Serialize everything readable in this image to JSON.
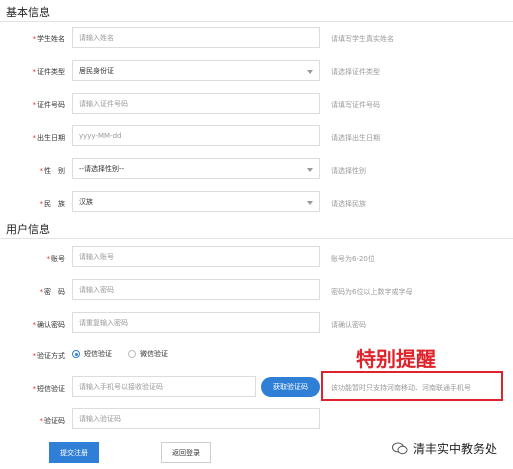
{
  "sections": {
    "basic": "基本信息",
    "user": "用户信息"
  },
  "fields": {
    "name": {
      "label": "学生姓名",
      "required": "*",
      "placeholder": "请输入姓名",
      "hint": "请填写学生真实姓名"
    },
    "idtype": {
      "label": "证件类型",
      "required": "*",
      "value": "居民身份证",
      "hint": "请选择证件类型"
    },
    "idnum": {
      "label": "证件号码",
      "required": "*",
      "placeholder": "请输入证件号码",
      "hint": "请填写证件号码"
    },
    "birth": {
      "label": "出生日期",
      "required": "*",
      "placeholder": "yyyy-MM-dd",
      "hint": "请选择出生日期"
    },
    "gender": {
      "label": "性　别",
      "required": "*",
      "value": "--请选择性别--",
      "hint": "请选择性别"
    },
    "nation": {
      "label": "民　族",
      "required": "*",
      "value": "汉族",
      "hint": "请选择民族"
    },
    "account": {
      "label": "账号",
      "required": "*",
      "placeholder": "请输入账号",
      "hint": "账号为6-20位"
    },
    "password": {
      "label": "密　码",
      "required": "*",
      "placeholder": "请输入密码",
      "hint": "密码为6位以上数字或字母"
    },
    "confirm": {
      "label": "确认密码",
      "required": "*",
      "placeholder": "请重复输入密码",
      "hint": "请确认密码"
    },
    "verify_method": {
      "label": "验证方式",
      "required": "*",
      "options": [
        "短信验证",
        "微信验证"
      ],
      "selected": "短信验证"
    },
    "sms": {
      "label": "短信验证",
      "required": "*",
      "placeholder": "请输入手机号以接收验证码",
      "button": "获取验证码",
      "hint": "该功能暂时只支持河南移动、河南联通手机号"
    },
    "code": {
      "label": "验证码",
      "required": "*",
      "placeholder": "请输入验证码"
    }
  },
  "actions": {
    "submit": "提交注册",
    "back": "返回登录"
  },
  "annotation": {
    "text": "特别提醒",
    "color": "#e0222a"
  },
  "watermark": {
    "text": "清丰实中教务处"
  },
  "colors": {
    "accent": "#2f7fd6",
    "required": "#e0322f",
    "highlight_box": "#e0222a"
  }
}
